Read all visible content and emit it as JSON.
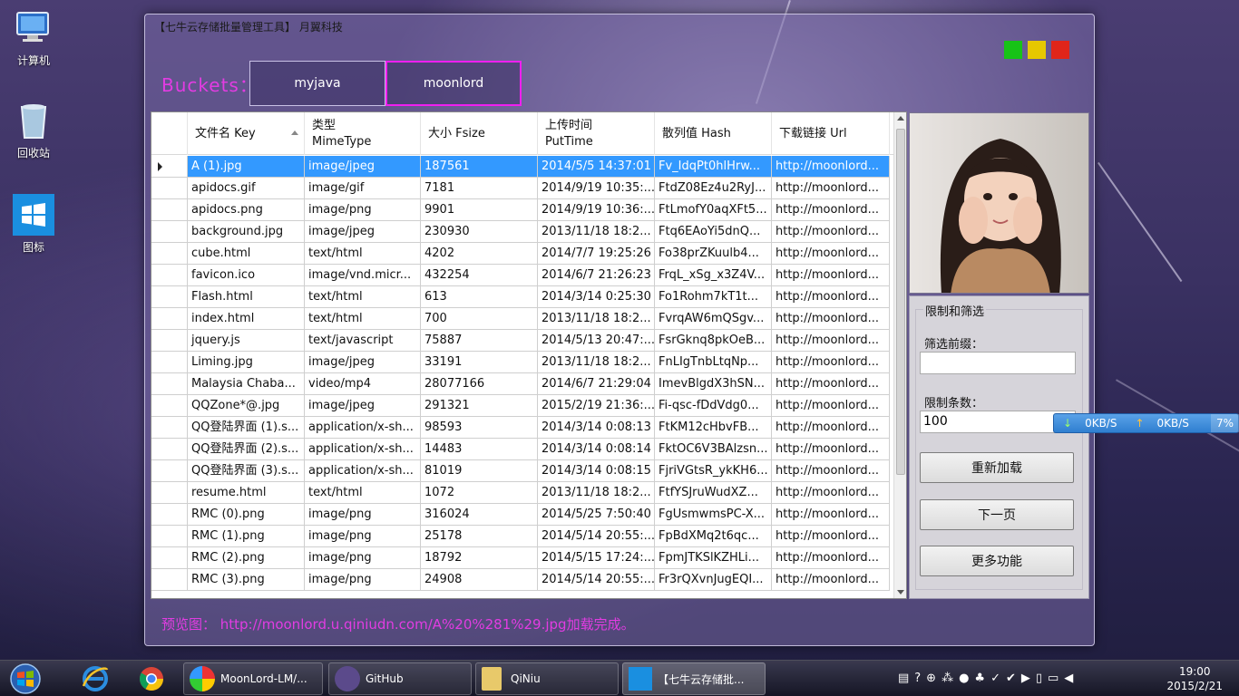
{
  "desktop": {
    "icons": [
      {
        "label": "计算机"
      },
      {
        "label": "回收站"
      },
      {
        "label": "图标"
      }
    ]
  },
  "window": {
    "title": "【七牛云存储批量管理工具】  月翼科技",
    "buckets_label": "Buckets：",
    "buckets": [
      {
        "label": "myjava",
        "active": false
      },
      {
        "label": "moonlord",
        "active": true
      }
    ]
  },
  "grid": {
    "columns": [
      {
        "line1": "文件名 Key",
        "line2": ""
      },
      {
        "line1": "类型",
        "line2": "MimeType"
      },
      {
        "line1": "大小 Fsize",
        "line2": ""
      },
      {
        "line1": "上传时间",
        "line2": "PutTime"
      },
      {
        "line1": "散列值 Hash",
        "line2": ""
      },
      {
        "line1": "下载链接 Url",
        "line2": ""
      }
    ],
    "rows": [
      [
        "A (1).jpg",
        "image/jpeg",
        "187561",
        "2014/5/5 14:37:01",
        "Fv_IdqPt0hlHrw...",
        "http://moonlord..."
      ],
      [
        "apidocs.gif",
        "image/gif",
        "7181",
        "2014/9/19 10:35:...",
        "FtdZ08Ez4u2RyJ...",
        "http://moonlord..."
      ],
      [
        "apidocs.png",
        "image/png",
        "9901",
        "2014/9/19 10:36:...",
        "FtLmofY0aqXFt5...",
        "http://moonlord..."
      ],
      [
        "background.jpg",
        "image/jpeg",
        "230930",
        "2013/11/18 18:2...",
        "Ftq6EAoYi5dnQ...",
        "http://moonlord..."
      ],
      [
        "cube.html",
        "text/html",
        "4202",
        "2014/7/7 19:25:26",
        "Fo38prZKuulb4...",
        "http://moonlord..."
      ],
      [
        "favicon.ico",
        "image/vnd.micr...",
        "432254",
        "2014/6/7 21:26:23",
        "FrqL_xSg_x3Z4V...",
        "http://moonlord..."
      ],
      [
        "Flash.html",
        "text/html",
        "613",
        "2014/3/14 0:25:30",
        "Fo1Rohm7kT1t...",
        "http://moonlord..."
      ],
      [
        "index.html",
        "text/html",
        "700",
        "2013/11/18 18:2...",
        "FvrqAW6mQSgv...",
        "http://moonlord..."
      ],
      [
        "jquery.js",
        "text/javascript",
        "75887",
        "2014/5/13 20:47:...",
        "FsrGknq8pkOeB...",
        "http://moonlord..."
      ],
      [
        "Liming.jpg",
        "image/jpeg",
        "33191",
        "2013/11/18 18:2...",
        "FnLIgTnbLtqNp...",
        "http://moonlord..."
      ],
      [
        "Malaysia Chaba...",
        "video/mp4",
        "28077166",
        "2014/6/7 21:29:04",
        "ImevBlgdX3hSN...",
        "http://moonlord..."
      ],
      [
        "QQZone*@.jpg",
        "image/jpeg",
        "291321",
        "2015/2/19 21:36:...",
        "Fi-qsc-fDdVdg0...",
        "http://moonlord..."
      ],
      [
        "QQ登陆界面 (1).s...",
        "application/x-sh...",
        "98593",
        "2014/3/14 0:08:13",
        "FtKM12cHbvFB...",
        "http://moonlord..."
      ],
      [
        "QQ登陆界面 (2).s...",
        "application/x-sh...",
        "14483",
        "2014/3/14 0:08:14",
        "FktOC6V3BAlzsn...",
        "http://moonlord..."
      ],
      [
        "QQ登陆界面 (3).s...",
        "application/x-sh...",
        "81019",
        "2014/3/14 0:08:15",
        "FjriVGtsR_ykKH6...",
        "http://moonlord..."
      ],
      [
        "resume.html",
        "text/html",
        "1072",
        "2013/11/18 18:2...",
        "FtfYSJruWudXZ...",
        "http://moonlord..."
      ],
      [
        "RMC (0).png",
        "image/png",
        "316024",
        "2014/5/25 7:50:40",
        "FgUsmwmsPC-X...",
        "http://moonlord..."
      ],
      [
        "RMC (1).png",
        "image/png",
        "25178",
        "2014/5/14 20:55:...",
        "FpBdXMq2t6qc...",
        "http://moonlord..."
      ],
      [
        "RMC (2).png",
        "image/png",
        "18792",
        "2014/5/15 17:24:...",
        "FpmJTKSlKZHLi...",
        "http://moonlord..."
      ],
      [
        "RMC (3).png",
        "image/png",
        "24908",
        "2014/5/14 20:55:...",
        "Fr3rQXvnJugEQI...",
        "http://moonlord..."
      ]
    ],
    "selected_row": 0
  },
  "panel": {
    "group_title": "限制和筛选",
    "prefix_label": "筛选前缀：",
    "prefix_value": "",
    "limit_label": "限制条数：",
    "limit_value": "100",
    "reload_button": "重新加载",
    "next_button": "下一页",
    "more_button": "更多功能"
  },
  "status": {
    "text": "预览图： http://moonlord.u.qiniudn.com/A%20%281%29.jpg加载完成。"
  },
  "net_widget": {
    "down": "0KB/S",
    "up": "0KB/S",
    "percent": "7%"
  },
  "taskbar": {
    "items": [
      {
        "label": "MoonLord-LM/..."
      },
      {
        "label": "GitHub"
      },
      {
        "label": "QiNiu"
      },
      {
        "label": "【七牛云存储批..."
      }
    ],
    "time": "19:00",
    "date": "2015/2/21"
  },
  "colors": {
    "accent_magenta": "#e23ce2",
    "selection_blue": "#3399ff",
    "traffic_green": "#17c317",
    "traffic_yellow": "#e6c800",
    "traffic_red": "#e0251a"
  }
}
